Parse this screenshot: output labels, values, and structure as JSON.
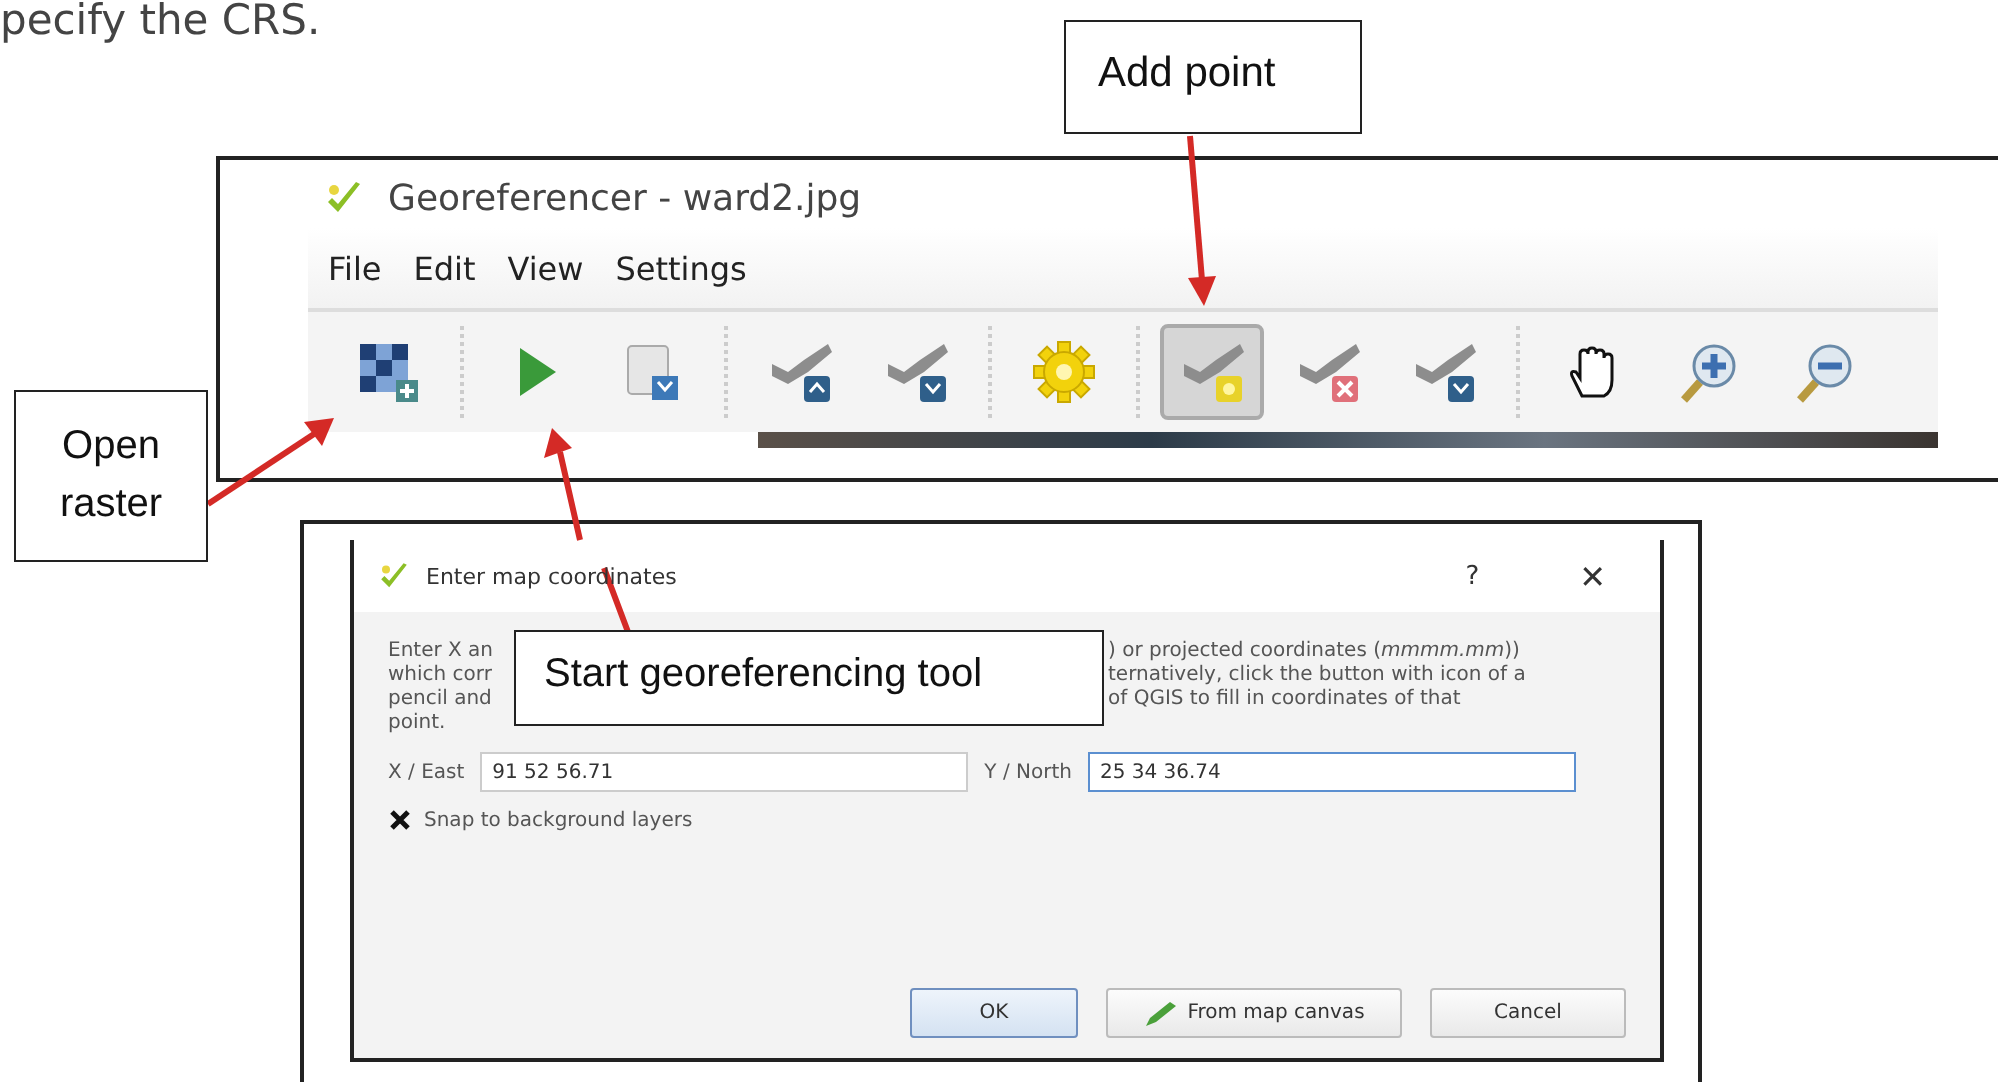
{
  "page_text": "pecify the CRS.",
  "georeferencer": {
    "window_title": "Georeferencer - ward2.jpg",
    "menu": [
      "File",
      "Edit",
      "View",
      "Settings"
    ],
    "toolbar": [
      {
        "kind": "raster",
        "selected": false
      },
      {
        "kind": "sep"
      },
      {
        "kind": "play",
        "selected": false
      },
      {
        "kind": "script",
        "selected": false
      },
      {
        "kind": "sep"
      },
      {
        "kind": "link-up",
        "selected": false
      },
      {
        "kind": "link-down",
        "selected": false
      },
      {
        "kind": "sep"
      },
      {
        "kind": "gear",
        "selected": false
      },
      {
        "kind": "sep"
      },
      {
        "kind": "add",
        "selected": true
      },
      {
        "kind": "delete",
        "selected": false
      },
      {
        "kind": "move",
        "selected": false
      },
      {
        "kind": "sep"
      },
      {
        "kind": "hand",
        "selected": false
      },
      {
        "kind": "zoom-in",
        "selected": false
      },
      {
        "kind": "zoom-out",
        "selected": false
      }
    ]
  },
  "dialog": {
    "title": "Enter map coordinates",
    "help": "?",
    "close": "✕",
    "text_left": [
      "Enter X an",
      "which corr",
      "pencil and",
      "point."
    ],
    "text_right": [
      ") or projected coordinates (*mmmm.mm*))",
      "ternatively, click the button with icon of a",
      "of QGIS to fill in coordinates of that"
    ],
    "x_label": "X / East",
    "x_value": "91 52 56.71",
    "y_label": "Y / North",
    "y_value": "25 34 36.74",
    "snap": {
      "label": "Snap to background layers",
      "checked": true
    },
    "buttons": [
      {
        "kind": "default",
        "label": "OK"
      },
      {
        "kind": "pencil",
        "label": "From map canvas"
      },
      {
        "kind": "plain",
        "label": "Cancel"
      }
    ]
  },
  "callouts": {
    "add_point": "Add point",
    "open_raster": [
      "Open",
      "raster"
    ],
    "start_tool": "Start georeferencing tool"
  }
}
